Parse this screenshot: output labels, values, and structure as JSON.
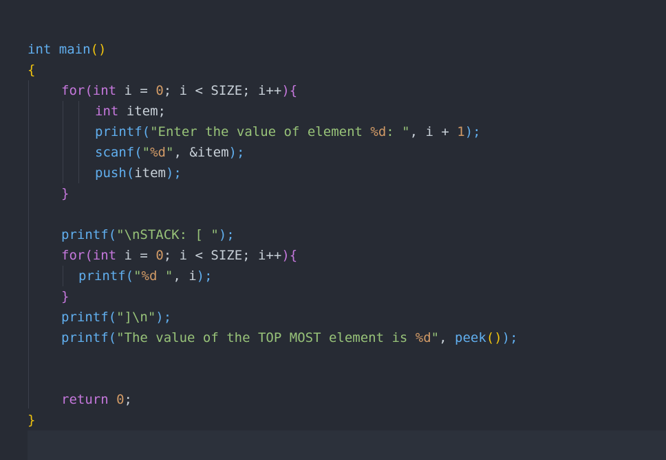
{
  "editor": {
    "lines": [
      {
        "tokens": [
          {
            "t": "int",
            "c": "kw2"
          },
          {
            "t": " ",
            "c": "plain"
          },
          {
            "t": "main",
            "c": "fn"
          },
          {
            "t": "()",
            "c": "paren"
          }
        ]
      },
      {
        "tokens": [
          {
            "t": "{",
            "c": "paren"
          }
        ]
      },
      {
        "tokens": [
          {
            "t": "for",
            "c": "kw"
          },
          {
            "t": "(",
            "c": "brace"
          },
          {
            "t": "int",
            "c": "kw"
          },
          {
            "t": " i = ",
            "c": "plain"
          },
          {
            "t": "0",
            "c": "num"
          },
          {
            "t": "; i < SIZE; i++",
            "c": "plain"
          },
          {
            "t": "){",
            "c": "brace"
          }
        ]
      },
      {
        "tokens": [
          {
            "t": "int",
            "c": "kw"
          },
          {
            "t": " item;",
            "c": "plain"
          }
        ]
      },
      {
        "tokens": [
          {
            "t": "printf",
            "c": "fn"
          },
          {
            "t": "(",
            "c": "fn"
          },
          {
            "t": "\"Enter the value of element ",
            "c": "str"
          },
          {
            "t": "%d",
            "c": "fmt"
          },
          {
            "t": ": \"",
            "c": "str"
          },
          {
            "t": ", i + ",
            "c": "plain"
          },
          {
            "t": "1",
            "c": "num"
          },
          {
            "t": ");",
            "c": "fn"
          }
        ]
      },
      {
        "tokens": [
          {
            "t": "scanf",
            "c": "fn"
          },
          {
            "t": "(",
            "c": "fn"
          },
          {
            "t": "\"",
            "c": "str"
          },
          {
            "t": "%d",
            "c": "fmt"
          },
          {
            "t": "\"",
            "c": "str"
          },
          {
            "t": ", &item",
            "c": "plain"
          },
          {
            "t": ");",
            "c": "fn"
          }
        ]
      },
      {
        "tokens": [
          {
            "t": "push",
            "c": "fn"
          },
          {
            "t": "(",
            "c": "fn"
          },
          {
            "t": "item",
            "c": "plain"
          },
          {
            "t": ");",
            "c": "fn"
          }
        ]
      },
      {
        "tokens": [
          {
            "t": "}",
            "c": "brace"
          }
        ]
      },
      {
        "tokens": []
      },
      {
        "tokens": [
          {
            "t": "printf",
            "c": "fn"
          },
          {
            "t": "(",
            "c": "fn"
          },
          {
            "t": "\"\\nSTACK: [ \"",
            "c": "str"
          },
          {
            "t": ");",
            "c": "fn"
          }
        ]
      },
      {
        "tokens": [
          {
            "t": "for",
            "c": "kw"
          },
          {
            "t": "(",
            "c": "brace"
          },
          {
            "t": "int",
            "c": "kw"
          },
          {
            "t": " i = ",
            "c": "plain"
          },
          {
            "t": "0",
            "c": "num"
          },
          {
            "t": "; i < SIZE; i++",
            "c": "plain"
          },
          {
            "t": "){",
            "c": "brace"
          }
        ]
      },
      {
        "tokens": [
          {
            "t": "printf",
            "c": "fn"
          },
          {
            "t": "(",
            "c": "fn"
          },
          {
            "t": "\"",
            "c": "str"
          },
          {
            "t": "%d",
            "c": "fmt"
          },
          {
            "t": " \"",
            "c": "str"
          },
          {
            "t": ", i",
            "c": "plain"
          },
          {
            "t": ");",
            "c": "fn"
          }
        ]
      },
      {
        "tokens": [
          {
            "t": "}",
            "c": "brace"
          }
        ]
      },
      {
        "tokens": [
          {
            "t": "printf",
            "c": "fn"
          },
          {
            "t": "(",
            "c": "fn"
          },
          {
            "t": "\"]\\n\"",
            "c": "str"
          },
          {
            "t": ");",
            "c": "fn"
          }
        ]
      },
      {
        "tokens": [
          {
            "t": "printf",
            "c": "fn"
          },
          {
            "t": "(",
            "c": "fn"
          },
          {
            "t": "\"The value of the TOP MOST element is ",
            "c": "str"
          },
          {
            "t": "%d",
            "c": "fmt"
          },
          {
            "t": "\"",
            "c": "str"
          },
          {
            "t": ", ",
            "c": "plain"
          },
          {
            "t": "peek",
            "c": "fn"
          },
          {
            "t": "()",
            "c": "paren"
          },
          {
            "t": ");",
            "c": "fn"
          }
        ]
      },
      {
        "tokens": []
      },
      {
        "tokens": []
      },
      {
        "tokens": [
          {
            "t": "return",
            "c": "kw"
          },
          {
            "t": " ",
            "c": "plain"
          },
          {
            "t": "0",
            "c": "num"
          },
          {
            "t": ";",
            "c": "plain"
          }
        ]
      },
      {
        "tokens": [
          {
            "t": "}",
            "c": "paren"
          }
        ]
      }
    ],
    "colors": {
      "background": "#272b34",
      "keyword": "#c678dd",
      "function": "#61afef",
      "string": "#98c379",
      "number": "#d19a66",
      "bracket": "#f1c40f"
    }
  }
}
